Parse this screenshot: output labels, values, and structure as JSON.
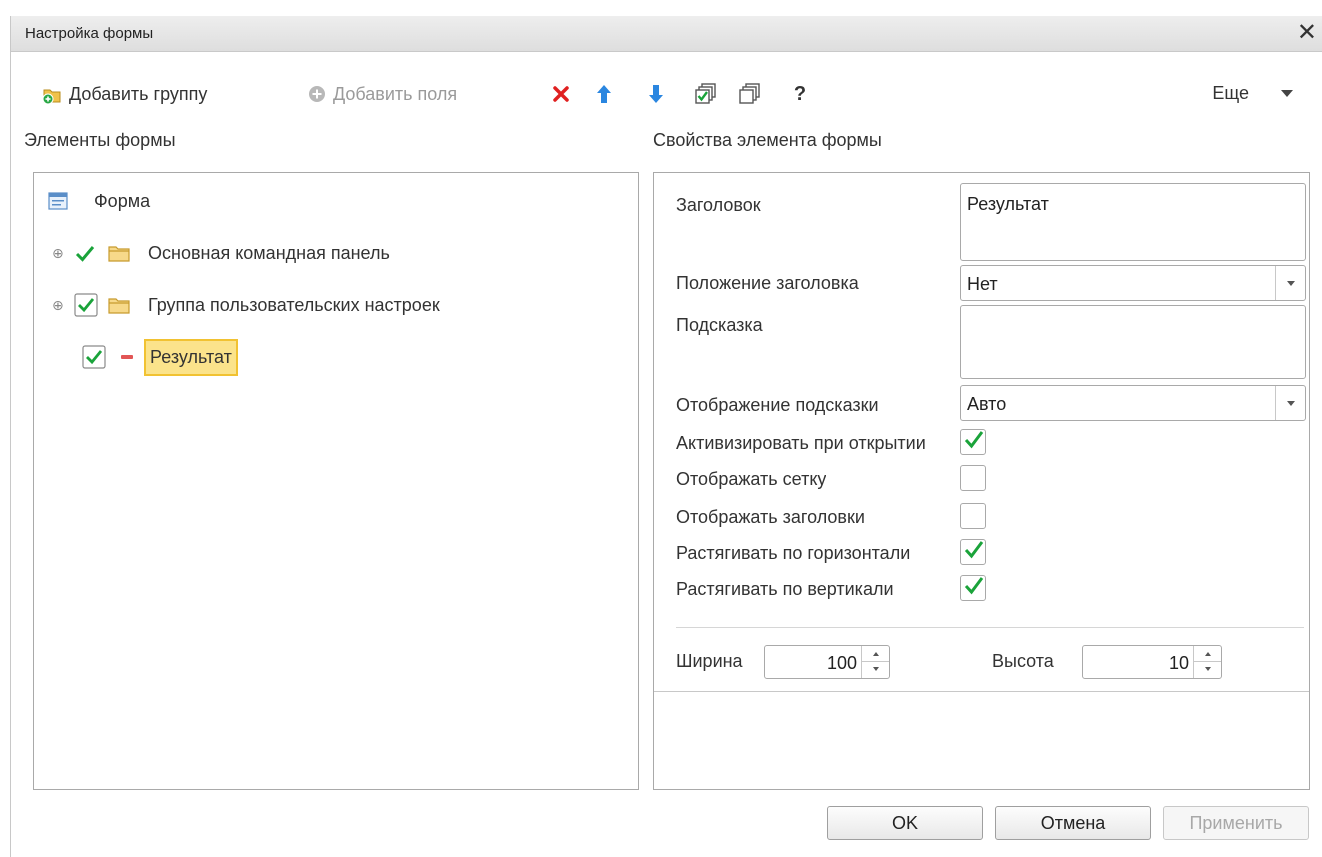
{
  "window": {
    "title": "Настройка формы"
  },
  "toolbar": {
    "add_group": "Добавить группу",
    "add_fields": "Добавить поля",
    "help": "?",
    "more": "Еще"
  },
  "left_panel": {
    "title": "Элементы формы",
    "tree": [
      {
        "label": "Форма"
      },
      {
        "label": "Основная командная панель"
      },
      {
        "label": "Группа пользовательских настроек"
      },
      {
        "label": "Результат"
      }
    ]
  },
  "right_panel": {
    "title": "Свойства элемента формы",
    "caption": {
      "label": "Заголовок",
      "value": "Результат"
    },
    "caption_position": {
      "label": "Положение заголовка",
      "value": "Нет"
    },
    "tooltip": {
      "label": "Подсказка",
      "value": ""
    },
    "tooltip_display": {
      "label": "Отображение подсказки",
      "value": "Авто"
    },
    "checks": [
      {
        "label": "Активизировать при открытии",
        "checked": true
      },
      {
        "label": "Отображать сетку",
        "checked": false
      },
      {
        "label": "Отображать заголовки",
        "checked": false
      },
      {
        "label": "Растягивать по горизонтали",
        "checked": true
      },
      {
        "label": "Растягивать по вертикали",
        "checked": true
      }
    ],
    "width": {
      "label": "Ширина",
      "value": "100"
    },
    "height": {
      "label": "Высота",
      "value": "10"
    }
  },
  "buttons": {
    "ok": "OK",
    "cancel": "Отмена",
    "apply": "Применить"
  },
  "colors": {
    "check_green": "#1aa33a",
    "delete_red": "#e02020",
    "arrow_blue": "#2a86e0",
    "selection": "#fbe38b"
  }
}
